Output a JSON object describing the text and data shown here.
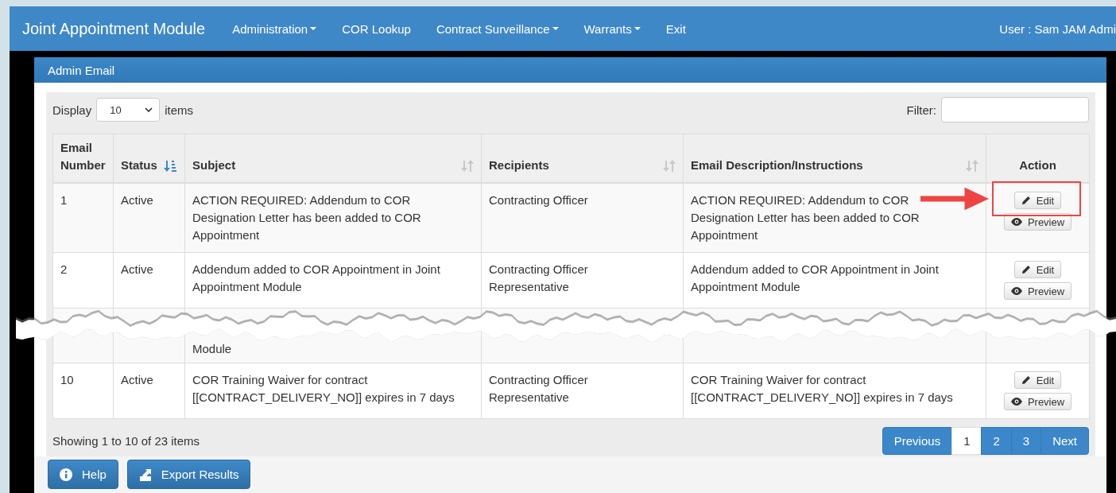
{
  "navbar": {
    "brand": "Joint Appointment Module",
    "menu": [
      {
        "label": "Administration",
        "dropdown": true
      },
      {
        "label": "COR Lookup",
        "dropdown": false
      },
      {
        "label": "Contract Surveillance",
        "dropdown": true
      },
      {
        "label": "Warrants",
        "dropdown": true
      },
      {
        "label": "Exit",
        "dropdown": false
      }
    ],
    "user": "User : Sam JAM Admi"
  },
  "panel": {
    "title": "Admin Email"
  },
  "length_control": {
    "label_before": "Display",
    "value": "10",
    "label_after": "items"
  },
  "filter": {
    "label": "Filter:"
  },
  "table": {
    "columns": [
      {
        "label": "Email Number"
      },
      {
        "label": "Status",
        "sortable": true,
        "sorted": true
      },
      {
        "label": "Subject",
        "sortable": true,
        "sorted": false
      },
      {
        "label": "Recipients",
        "sortable": true,
        "sorted": false
      },
      {
        "label": "Email Description/Instructions",
        "sortable": true,
        "sorted": false
      },
      {
        "label": "Action"
      }
    ],
    "rows": [
      {
        "kind": "full",
        "number": "1",
        "status": "Active",
        "subject": "ACTION REQUIRED: Addendum to COR Designation Letter has been added to COR Appointment",
        "recipients": "Contracting Officer",
        "description": "ACTION REQUIRED: Addendum to COR Designation Letter has been added to COR Appointment",
        "actions": [
          "Edit",
          "Preview"
        ],
        "highlighted": true
      },
      {
        "kind": "full",
        "number": "2",
        "status": "Active",
        "subject": "Addendum added to COR Appointment in Joint Appointment Module",
        "recipients": "Contracting Officer Representative",
        "description": "Addendum added to COR Appointment in Joint Appointment Module",
        "actions": [
          "Edit",
          "Preview"
        ],
        "highlighted": false
      },
      {
        "kind": "torn",
        "subject": "Module"
      },
      {
        "kind": "full",
        "number": "10",
        "status": "Active",
        "subject": "COR Training Waiver for contract [[CONTRACT_DELIVERY_NO]] expires in 7 days",
        "recipients": "Contracting Officer Representative",
        "description": "COR Training Waiver for contract [[CONTRACT_DELIVERY_NO]] expires in 7 days",
        "actions": [
          "Edit",
          "Preview"
        ],
        "highlighted": false
      }
    ]
  },
  "info": "Showing 1 to 10 of 23 items",
  "pagination": [
    {
      "label": "Previous",
      "selected": false
    },
    {
      "label": "1",
      "selected": true
    },
    {
      "label": "2",
      "selected": false
    },
    {
      "label": "3",
      "selected": false
    },
    {
      "label": "Next",
      "selected": false
    }
  ],
  "footer_buttons": [
    {
      "label": "Help"
    },
    {
      "label": "Export Results"
    }
  ]
}
